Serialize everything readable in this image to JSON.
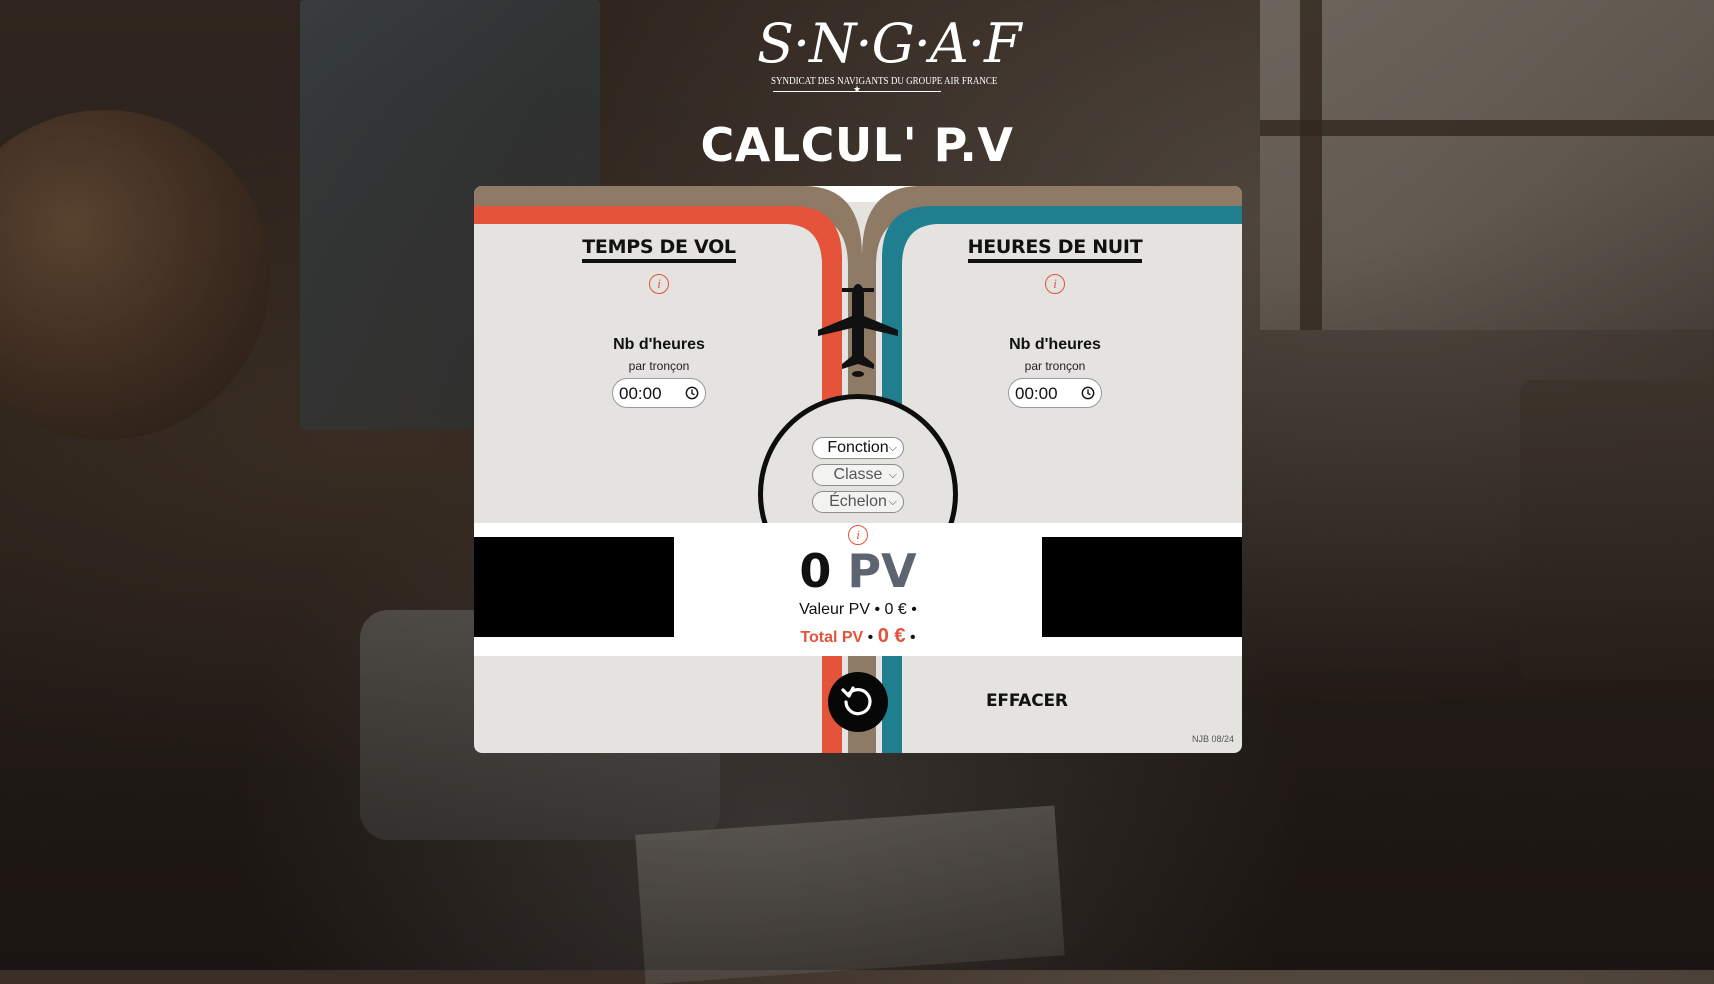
{
  "header": {
    "logo_word": "S·N·G·A·F",
    "logo_tagline": "SYNDICAT DES NAVIGANTS DU GROUPE AIR FRANCE",
    "title": "CALCUL' P.V"
  },
  "colors": {
    "accent_red": "#e5533a",
    "accent_teal": "#1f7f8f",
    "accent_brown": "#8f7a66"
  },
  "left_panel": {
    "title": "TEMPS DE VOL",
    "info_icon": "i",
    "field_label": "Nb d'heures",
    "field_sub": "par tronçon",
    "value": "00:00"
  },
  "right_panel": {
    "title": "HEURES DE NUIT",
    "info_icon": "i",
    "field_label": "Nb d'heures",
    "field_sub": "par tronçon",
    "value": "00:00"
  },
  "selects": {
    "fonction": "Fonction",
    "classe": "Classe",
    "echelon": "Échelon"
  },
  "result": {
    "info_icon": "i",
    "pv_value": "0",
    "pv_unit": "PV",
    "valeur_line": "Valeur PV • 0 € •",
    "total_label": "Total PV",
    "total_bullet": "•",
    "total_value": "0 €",
    "total_bullet_end": "•"
  },
  "actions": {
    "reset_label": "EFFACER"
  },
  "footer": {
    "version": "NJB 08/24"
  }
}
